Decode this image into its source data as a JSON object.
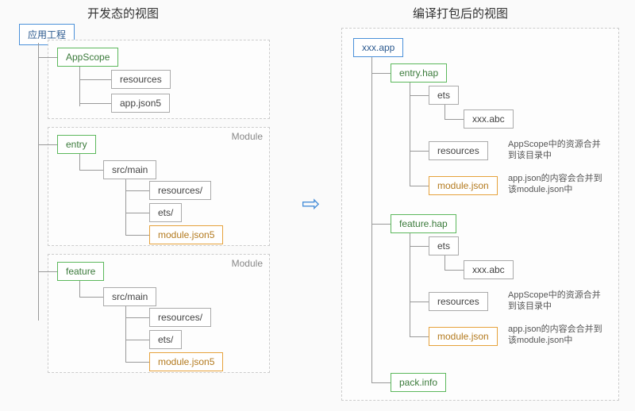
{
  "titles": {
    "left": "开发态的视图",
    "right": "编译打包后的视图"
  },
  "left": {
    "root": "应用工程",
    "appscope": {
      "name": "AppScope",
      "children": [
        "resources",
        "app.json5"
      ]
    },
    "modules": [
      {
        "name": "entry",
        "label": "Module",
        "srcmain": "src/main",
        "children": [
          "resources/",
          "ets/",
          "module.json5"
        ]
      },
      {
        "name": "feature",
        "label": "Module",
        "srcmain": "src/main",
        "children": [
          "resources/",
          "ets/",
          "module.json5"
        ]
      }
    ]
  },
  "right": {
    "root": "xxx.app",
    "haps": [
      {
        "name": "entry.hap",
        "ets": "ets",
        "abc": "xxx.abc",
        "resources": "resources",
        "module": "module.json",
        "note_res": "AppScope中的资源合并到该目录中",
        "note_mod": "app.json的内容会合并到该module.json中"
      },
      {
        "name": "feature.hap",
        "ets": "ets",
        "abc": "xxx.abc",
        "resources": "resources",
        "module": "module.json",
        "note_res": "AppScope中的资源合并到该目录中",
        "note_mod": "app.json的内容会合并到该module.json中"
      }
    ],
    "pack": "pack.info"
  },
  "chart_data": {
    "type": "table",
    "description": "Two tree diagrams comparing project structure in development view vs compiled/packaged view",
    "left_tree": {
      "root": "应用工程",
      "children": [
        {
          "name": "AppScope",
          "children": [
            "resources",
            "app.json5"
          ]
        },
        {
          "name": "entry",
          "tag": "Module",
          "children": [
            {
              "name": "src/main",
              "children": [
                "resources/",
                "ets/",
                "module.json5"
              ]
            }
          ]
        },
        {
          "name": "feature",
          "tag": "Module",
          "children": [
            {
              "name": "src/main",
              "children": [
                "resources/",
                "ets/",
                "module.json5"
              ]
            }
          ]
        }
      ]
    },
    "right_tree": {
      "root": "xxx.app",
      "children": [
        {
          "name": "entry.hap",
          "children": [
            {
              "name": "ets",
              "children": [
                "xxx.abc"
              ]
            },
            {
              "name": "resources",
              "note": "AppScope中的资源合并到该目录中"
            },
            {
              "name": "module.json",
              "note": "app.json的内容会合并到该module.json中"
            }
          ]
        },
        {
          "name": "feature.hap",
          "children": [
            {
              "name": "ets",
              "children": [
                "xxx.abc"
              ]
            },
            {
              "name": "resources",
              "note": "AppScope中的资源合并到该目录中"
            },
            {
              "name": "module.json",
              "note": "app.json的内容会合并到该module.json中"
            }
          ]
        },
        {
          "name": "pack.info"
        }
      ]
    }
  }
}
